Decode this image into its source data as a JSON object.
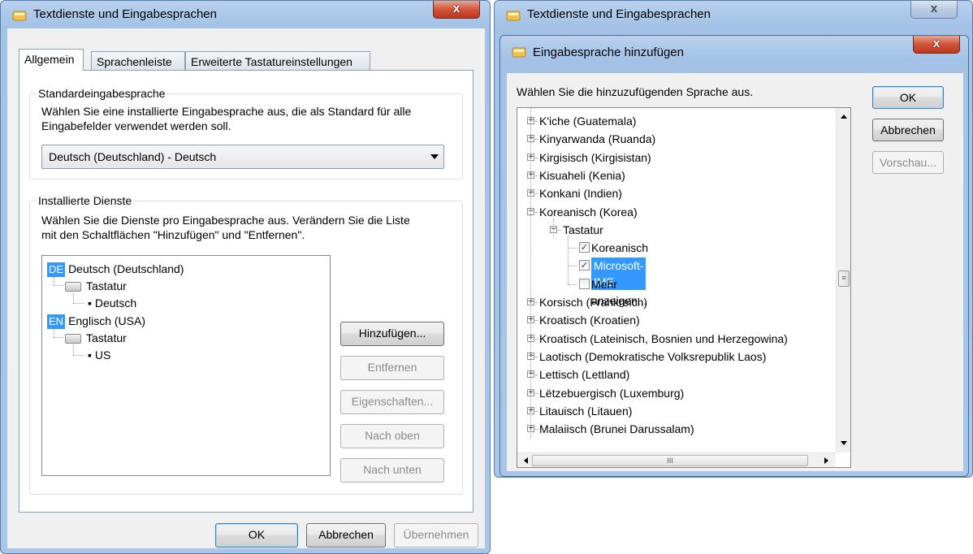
{
  "left_window": {
    "title": "Textdienste und Eingabesprachen",
    "close_label": "x",
    "tabs": [
      {
        "label": "Allgemein"
      },
      {
        "label": "Sprachenleiste"
      },
      {
        "label": "Erweiterte Tastatureinstellungen"
      }
    ],
    "default_group": {
      "title": "Standardeingabesprache",
      "description_line1": "Wählen Sie eine installierte Eingabesprache aus, die als Standard für alle",
      "description_line2": "Eingabefelder verwendet werden soll.",
      "selected_value": "Deutsch (Deutschland) - Deutsch"
    },
    "services_group": {
      "title": "Installierte Dienste",
      "description_line1": "Wählen Sie die Dienste pro Eingabesprache aus. Verändern Sie die Liste",
      "description_line2": "mit den Schaltflächen \"Hinzufügen\" und \"Entfernen\".",
      "tree": [
        {
          "badge": "DE",
          "language": "Deutsch (Deutschland)",
          "category": "Tastatur",
          "layout": "Deutsch"
        },
        {
          "badge": "EN",
          "language": "Englisch (USA)",
          "category": "Tastatur",
          "layout": "US"
        }
      ],
      "buttons": {
        "add": "Hinzufügen...",
        "remove": "Entfernen",
        "properties": "Eigenschaften...",
        "move_up": "Nach oben",
        "move_down": "Nach unten"
      }
    },
    "footer": {
      "ok": "OK",
      "cancel": "Abbrechen",
      "apply": "Übernehmen"
    }
  },
  "right_window": {
    "title": "Textdienste und Eingabesprachen",
    "close_label": "x",
    "dialog": {
      "title": "Eingabesprache hinzufügen",
      "close_label": "x",
      "instruction": "Wählen Sie die hinzuzufügenden Sprache aus.",
      "buttons": {
        "ok": "OK",
        "cancel": "Abbrechen",
        "preview": "Vorschau..."
      },
      "languages_before": [
        "K'iche (Guatemala)",
        "Kinyarwanda (Ruanda)",
        "Kirgisisch (Kirgisistan)",
        "Kisuaheli (Kenia)",
        "Konkani (Indien)"
      ],
      "expanded_language": "Koreanisch (Korea)",
      "expanded_category": "Tastatur",
      "keyboard_options": [
        {
          "label": "Koreanisch",
          "checked": true,
          "selected": false
        },
        {
          "label": "Microsoft-IME",
          "checked": true,
          "selected": true
        },
        {
          "label": "Mehr anzeigen...",
          "checked": false,
          "selected": false
        }
      ],
      "languages_after": [
        "Korsisch (Frankreich)",
        "Kroatisch (Kroatien)",
        "Kroatisch (Lateinisch, Bosnien und Herzegowina)",
        "Laotisch (Demokratische Volksrepublik Laos)",
        "Lettisch (Lettland)",
        "Lëtzebuergisch (Luxemburg)",
        "Litauisch (Litauen)",
        "Malaiisch (Brunei Darussalam)"
      ],
      "hscroll_grip": "III"
    }
  },
  "colors": {
    "selection": "#3399ff",
    "title_bar": "#a9c6e8",
    "close_button": "#c8412a"
  }
}
